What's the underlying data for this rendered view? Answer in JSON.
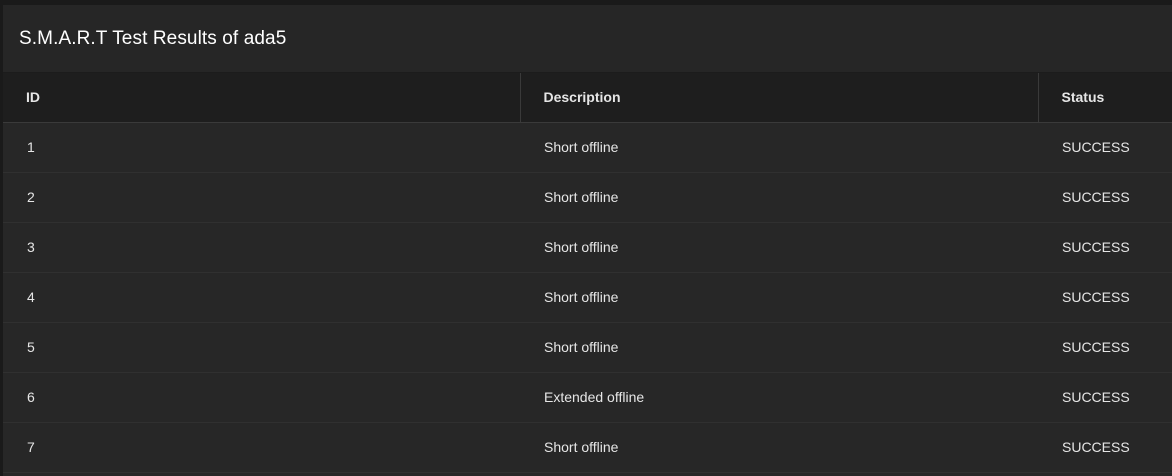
{
  "card": {
    "title": "S.M.A.R.T Test Results of ada5"
  },
  "table": {
    "headers": [
      "ID",
      "Description",
      "Status"
    ],
    "rows": [
      {
        "id": "1",
        "description": "Short offline",
        "status": "SUCCESS"
      },
      {
        "id": "2",
        "description": "Short offline",
        "status": "SUCCESS"
      },
      {
        "id": "3",
        "description": "Short offline",
        "status": "SUCCESS"
      },
      {
        "id": "4",
        "description": "Short offline",
        "status": "SUCCESS"
      },
      {
        "id": "5",
        "description": "Short offline",
        "status": "SUCCESS"
      },
      {
        "id": "6",
        "description": "Extended offline",
        "status": "SUCCESS"
      },
      {
        "id": "7",
        "description": "Short offline",
        "status": "SUCCESS"
      }
    ]
  },
  "colors": {
    "background": "#1a1a1a",
    "card": "#272727",
    "header_row": "#1e1e1e",
    "text": "#e6e6e6"
  }
}
